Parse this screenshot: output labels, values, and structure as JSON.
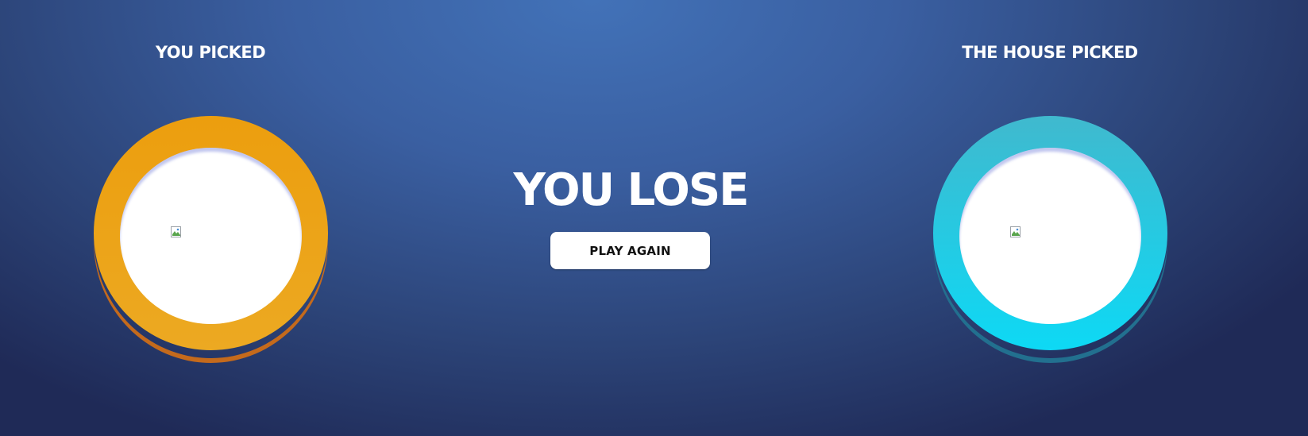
{
  "player": {
    "label": "YOU PICKED",
    "chip_color": "#eca922",
    "chip_icon": "broken-image-icon"
  },
  "house": {
    "label": "THE HOUSE PICKED",
    "chip_color": "#1fd0ea",
    "chip_icon": "broken-image-icon"
  },
  "result": {
    "text": "YOU LOSE",
    "button_label": "PLAY AGAIN"
  },
  "colors": {
    "background": "#3a5fa1",
    "player_ring": "#eca922",
    "house_ring": "#1fd0ea"
  }
}
